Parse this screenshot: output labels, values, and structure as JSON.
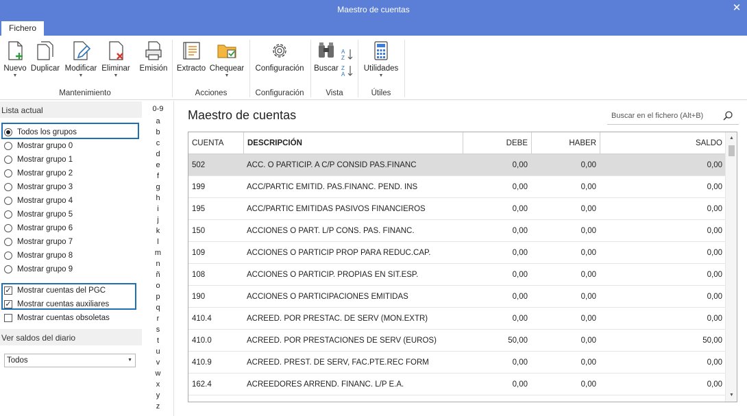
{
  "window": {
    "title": "Maestro de cuentas",
    "close": "✕"
  },
  "tabs": [
    "Fichero"
  ],
  "ribbon": {
    "buttons": {
      "nuevo": "Nuevo",
      "duplicar": "Duplicar",
      "modificar": "Modificar",
      "eliminar": "Eliminar",
      "emision": "Emisión",
      "extracto": "Extracto",
      "chequear": "Chequear",
      "configuracion": "Configuración",
      "buscar": "Buscar",
      "utilidades": "Utilidades"
    },
    "groups": {
      "mantenimiento": "Mantenimiento",
      "acciones": "Acciones",
      "configuracion": "Configuración",
      "vista": "Vista",
      "utiles": "Útiles"
    }
  },
  "left_panel": {
    "lista_actual": "Lista actual",
    "groups": [
      "Todos los grupos",
      "Mostrar grupo 0",
      "Mostrar grupo 1",
      "Mostrar grupo 2",
      "Mostrar grupo 3",
      "Mostrar grupo 4",
      "Mostrar grupo 5",
      "Mostrar grupo 6",
      "Mostrar grupo 7",
      "Mostrar grupo 8",
      "Mostrar grupo 9"
    ],
    "selected_group": "Todos los grupos",
    "checks": [
      {
        "label": "Mostrar cuentas del PGC",
        "checked": true
      },
      {
        "label": "Mostrar cuentas auxiliares",
        "checked": true
      },
      {
        "label": "Mostrar cuentas obsoletas",
        "checked": false
      }
    ],
    "ver_saldos": "Ver saldos del diario",
    "saldos_value": "Todos"
  },
  "alphabet": [
    "0-9",
    "a",
    "b",
    "c",
    "d",
    "e",
    "f",
    "g",
    "h",
    "i",
    "j",
    "k",
    "l",
    "m",
    "n",
    "ñ",
    "o",
    "p",
    "q",
    "r",
    "s",
    "t",
    "u",
    "v",
    "w",
    "x",
    "y",
    "z"
  ],
  "main": {
    "title": "Maestro de cuentas",
    "search_placeholder": "Buscar en el fichero (Alt+B)",
    "columns": [
      "CUENTA",
      "DESCRIPCIÓN",
      "DEBE",
      "HABER",
      "SALDO"
    ],
    "rows": [
      [
        "502",
        "ACC. O PARTICIP. A C/P CONSID PAS.FINANC",
        "0,00",
        "0,00",
        "0,00"
      ],
      [
        "199",
        "ACC/PARTIC EMITID. PAS.FINANC. PEND. INS",
        "0,00",
        "0,00",
        "0,00"
      ],
      [
        "195",
        "ACC/PARTIC EMITIDAS PASIVOS FINANCIEROS",
        "0,00",
        "0,00",
        "0,00"
      ],
      [
        "150",
        "ACCIONES O PART. L/P CONS. PAS. FINANC.",
        "0,00",
        "0,00",
        "0,00"
      ],
      [
        "109",
        "ACCIONES O PARTICIP PROP PARA REDUC.CAP.",
        "0,00",
        "0,00",
        "0,00"
      ],
      [
        "108",
        "ACCIONES O PARTICIP. PROPIAS EN SIT.ESP.",
        "0,00",
        "0,00",
        "0,00"
      ],
      [
        "190",
        "ACCIONES O PARTICIPACIONES EMITIDAS",
        "0,00",
        "0,00",
        "0,00"
      ],
      [
        "410.4",
        "ACREED. POR PRESTAC. DE SERV (MON.EXTR)",
        "0,00",
        "0,00",
        "0,00"
      ],
      [
        "410.0",
        "ACREED. POR PRESTACIONES DE SERV (EUROS)",
        "50,00",
        "0,00",
        "50,00"
      ],
      [
        "410.9",
        "ACREED. PREST. DE SERV, FAC.PTE.REC FORM",
        "0,00",
        "0,00",
        "0,00"
      ],
      [
        "162.4",
        "ACREEDORES ARREND. FINANC. L/P E.A.",
        "0,00",
        "0,00",
        "0,00"
      ]
    ],
    "selected_row": 0
  }
}
